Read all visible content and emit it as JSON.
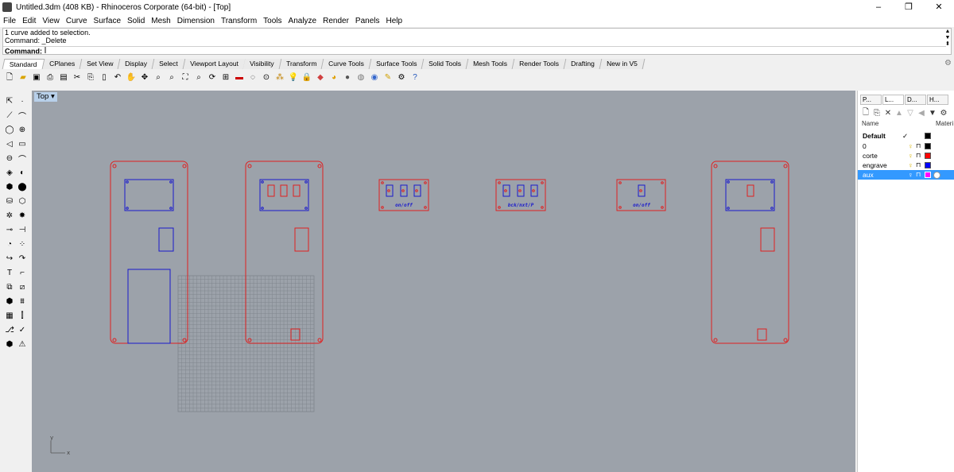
{
  "window": {
    "title": "Untitled.3dm (408 KB) - Rhinoceros Corporate (64-bit) - [Top]",
    "minimize": "–",
    "maximize": "❐",
    "close": "✕"
  },
  "menu": [
    "File",
    "Edit",
    "View",
    "Curve",
    "Surface",
    "Solid",
    "Mesh",
    "Dimension",
    "Transform",
    "Tools",
    "Analyze",
    "Render",
    "Panels",
    "Help"
  ],
  "command": {
    "history": [
      "1 curve added to selection.",
      "Command: _Delete"
    ],
    "prompt_label": "Command:",
    "value": ""
  },
  "tabs": [
    "Standard",
    "CPlanes",
    "Set View",
    "Display",
    "Select",
    "Viewport Layout",
    "Visibility",
    "Transform",
    "Curve Tools",
    "Surface Tools",
    "Solid Tools",
    "Mesh Tools",
    "Render Tools",
    "Drafting",
    "New in V5"
  ],
  "active_tab": "Standard",
  "viewport": {
    "name": "Top",
    "axis_y": "y",
    "axis_x": "x",
    "labels": {
      "a": "on/off",
      "b": "bck/nxt/P",
      "c": "on/off"
    }
  },
  "panel": {
    "tabs": [
      "P...",
      "L...",
      "D...",
      "H..."
    ],
    "columns": {
      "name": "Name",
      "material": "Materi"
    },
    "layers": [
      {
        "name": "Default",
        "current": "✓",
        "color": "#000000",
        "material": ""
      },
      {
        "name": "0",
        "current": "",
        "color": "#000000",
        "material": ""
      },
      {
        "name": "corte",
        "current": "",
        "color": "#ff0000",
        "material": ""
      },
      {
        "name": "engrave",
        "current": "",
        "color": "#0000ff",
        "material": ""
      },
      {
        "name": "aux",
        "current": "",
        "color": "#ff00ff",
        "material": "#ffffff"
      }
    ]
  },
  "colors": {
    "cut": "#e02020",
    "engrave": "#1a1acc",
    "viewport_bg": "#9ca2aa",
    "grid": "#7e838b",
    "selection": "#3399ff"
  }
}
